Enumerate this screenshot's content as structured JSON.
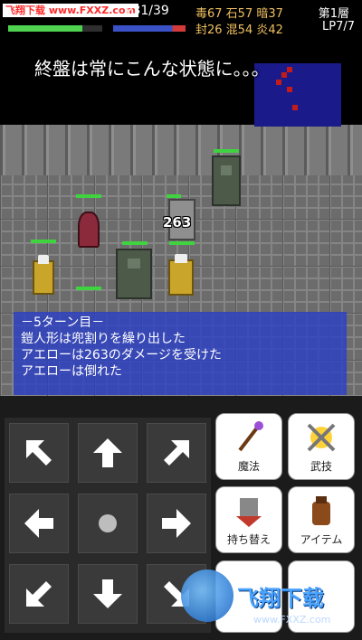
{
  "hud": {
    "site_mark": "飞翔下载 www.FXXZ.com",
    "hp_text": "P31/39",
    "hp_fraction": 0.79,
    "status_row1": "毒67 石57 暗37",
    "status_row2": "封26 混54 炎42",
    "floor": "第1層",
    "lp": "LP7/7"
  },
  "caption": "終盤は常にこんな状態に。。。",
  "battle": {
    "damage_popup": "263"
  },
  "log": {
    "lines": [
      "－5ターン目－",
      "鎧人形は兜割りを繰り出した",
      "アエローは263のダメージを受けた",
      "アエローは倒れた"
    ]
  },
  "actions": {
    "magic": "魔法",
    "skill": "武技",
    "swap": "持ち替え",
    "item": "アイテム"
  },
  "watermark": {
    "brand": "飞翔下载",
    "url": "www.FXXZ.com"
  },
  "colors": {
    "log_bg": "#2838c8",
    "hp": "#4fd24f",
    "status": "#f0c060"
  }
}
